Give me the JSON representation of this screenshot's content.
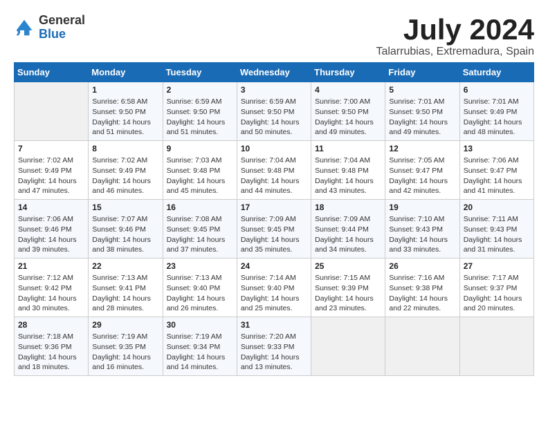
{
  "header": {
    "logo_general": "General",
    "logo_blue": "Blue",
    "month_title": "July 2024",
    "location": "Talarrubias, Extremadura, Spain"
  },
  "weekdays": [
    "Sunday",
    "Monday",
    "Tuesday",
    "Wednesday",
    "Thursday",
    "Friday",
    "Saturday"
  ],
  "weeks": [
    [
      {
        "day": "",
        "sunrise": "",
        "sunset": "",
        "daylight": ""
      },
      {
        "day": "1",
        "sunrise": "Sunrise: 6:58 AM",
        "sunset": "Sunset: 9:50 PM",
        "daylight": "Daylight: 14 hours and 51 minutes."
      },
      {
        "day": "2",
        "sunrise": "Sunrise: 6:59 AM",
        "sunset": "Sunset: 9:50 PM",
        "daylight": "Daylight: 14 hours and 51 minutes."
      },
      {
        "day": "3",
        "sunrise": "Sunrise: 6:59 AM",
        "sunset": "Sunset: 9:50 PM",
        "daylight": "Daylight: 14 hours and 50 minutes."
      },
      {
        "day": "4",
        "sunrise": "Sunrise: 7:00 AM",
        "sunset": "Sunset: 9:50 PM",
        "daylight": "Daylight: 14 hours and 49 minutes."
      },
      {
        "day": "5",
        "sunrise": "Sunrise: 7:01 AM",
        "sunset": "Sunset: 9:50 PM",
        "daylight": "Daylight: 14 hours and 49 minutes."
      },
      {
        "day": "6",
        "sunrise": "Sunrise: 7:01 AM",
        "sunset": "Sunset: 9:49 PM",
        "daylight": "Daylight: 14 hours and 48 minutes."
      }
    ],
    [
      {
        "day": "7",
        "sunrise": "Sunrise: 7:02 AM",
        "sunset": "Sunset: 9:49 PM",
        "daylight": "Daylight: 14 hours and 47 minutes."
      },
      {
        "day": "8",
        "sunrise": "Sunrise: 7:02 AM",
        "sunset": "Sunset: 9:49 PM",
        "daylight": "Daylight: 14 hours and 46 minutes."
      },
      {
        "day": "9",
        "sunrise": "Sunrise: 7:03 AM",
        "sunset": "Sunset: 9:48 PM",
        "daylight": "Daylight: 14 hours and 45 minutes."
      },
      {
        "day": "10",
        "sunrise": "Sunrise: 7:04 AM",
        "sunset": "Sunset: 9:48 PM",
        "daylight": "Daylight: 14 hours and 44 minutes."
      },
      {
        "day": "11",
        "sunrise": "Sunrise: 7:04 AM",
        "sunset": "Sunset: 9:48 PM",
        "daylight": "Daylight: 14 hours and 43 minutes."
      },
      {
        "day": "12",
        "sunrise": "Sunrise: 7:05 AM",
        "sunset": "Sunset: 9:47 PM",
        "daylight": "Daylight: 14 hours and 42 minutes."
      },
      {
        "day": "13",
        "sunrise": "Sunrise: 7:06 AM",
        "sunset": "Sunset: 9:47 PM",
        "daylight": "Daylight: 14 hours and 41 minutes."
      }
    ],
    [
      {
        "day": "14",
        "sunrise": "Sunrise: 7:06 AM",
        "sunset": "Sunset: 9:46 PM",
        "daylight": "Daylight: 14 hours and 39 minutes."
      },
      {
        "day": "15",
        "sunrise": "Sunrise: 7:07 AM",
        "sunset": "Sunset: 9:46 PM",
        "daylight": "Daylight: 14 hours and 38 minutes."
      },
      {
        "day": "16",
        "sunrise": "Sunrise: 7:08 AM",
        "sunset": "Sunset: 9:45 PM",
        "daylight": "Daylight: 14 hours and 37 minutes."
      },
      {
        "day": "17",
        "sunrise": "Sunrise: 7:09 AM",
        "sunset": "Sunset: 9:45 PM",
        "daylight": "Daylight: 14 hours and 35 minutes."
      },
      {
        "day": "18",
        "sunrise": "Sunrise: 7:09 AM",
        "sunset": "Sunset: 9:44 PM",
        "daylight": "Daylight: 14 hours and 34 minutes."
      },
      {
        "day": "19",
        "sunrise": "Sunrise: 7:10 AM",
        "sunset": "Sunset: 9:43 PM",
        "daylight": "Daylight: 14 hours and 33 minutes."
      },
      {
        "day": "20",
        "sunrise": "Sunrise: 7:11 AM",
        "sunset": "Sunset: 9:43 PM",
        "daylight": "Daylight: 14 hours and 31 minutes."
      }
    ],
    [
      {
        "day": "21",
        "sunrise": "Sunrise: 7:12 AM",
        "sunset": "Sunset: 9:42 PM",
        "daylight": "Daylight: 14 hours and 30 minutes."
      },
      {
        "day": "22",
        "sunrise": "Sunrise: 7:13 AM",
        "sunset": "Sunset: 9:41 PM",
        "daylight": "Daylight: 14 hours and 28 minutes."
      },
      {
        "day": "23",
        "sunrise": "Sunrise: 7:13 AM",
        "sunset": "Sunset: 9:40 PM",
        "daylight": "Daylight: 14 hours and 26 minutes."
      },
      {
        "day": "24",
        "sunrise": "Sunrise: 7:14 AM",
        "sunset": "Sunset: 9:40 PM",
        "daylight": "Daylight: 14 hours and 25 minutes."
      },
      {
        "day": "25",
        "sunrise": "Sunrise: 7:15 AM",
        "sunset": "Sunset: 9:39 PM",
        "daylight": "Daylight: 14 hours and 23 minutes."
      },
      {
        "day": "26",
        "sunrise": "Sunrise: 7:16 AM",
        "sunset": "Sunset: 9:38 PM",
        "daylight": "Daylight: 14 hours and 22 minutes."
      },
      {
        "day": "27",
        "sunrise": "Sunrise: 7:17 AM",
        "sunset": "Sunset: 9:37 PM",
        "daylight": "Daylight: 14 hours and 20 minutes."
      }
    ],
    [
      {
        "day": "28",
        "sunrise": "Sunrise: 7:18 AM",
        "sunset": "Sunset: 9:36 PM",
        "daylight": "Daylight: 14 hours and 18 minutes."
      },
      {
        "day": "29",
        "sunrise": "Sunrise: 7:19 AM",
        "sunset": "Sunset: 9:35 PM",
        "daylight": "Daylight: 14 hours and 16 minutes."
      },
      {
        "day": "30",
        "sunrise": "Sunrise: 7:19 AM",
        "sunset": "Sunset: 9:34 PM",
        "daylight": "Daylight: 14 hours and 14 minutes."
      },
      {
        "day": "31",
        "sunrise": "Sunrise: 7:20 AM",
        "sunset": "Sunset: 9:33 PM",
        "daylight": "Daylight: 14 hours and 13 minutes."
      },
      {
        "day": "",
        "sunrise": "",
        "sunset": "",
        "daylight": ""
      },
      {
        "day": "",
        "sunrise": "",
        "sunset": "",
        "daylight": ""
      },
      {
        "day": "",
        "sunrise": "",
        "sunset": "",
        "daylight": ""
      }
    ]
  ]
}
